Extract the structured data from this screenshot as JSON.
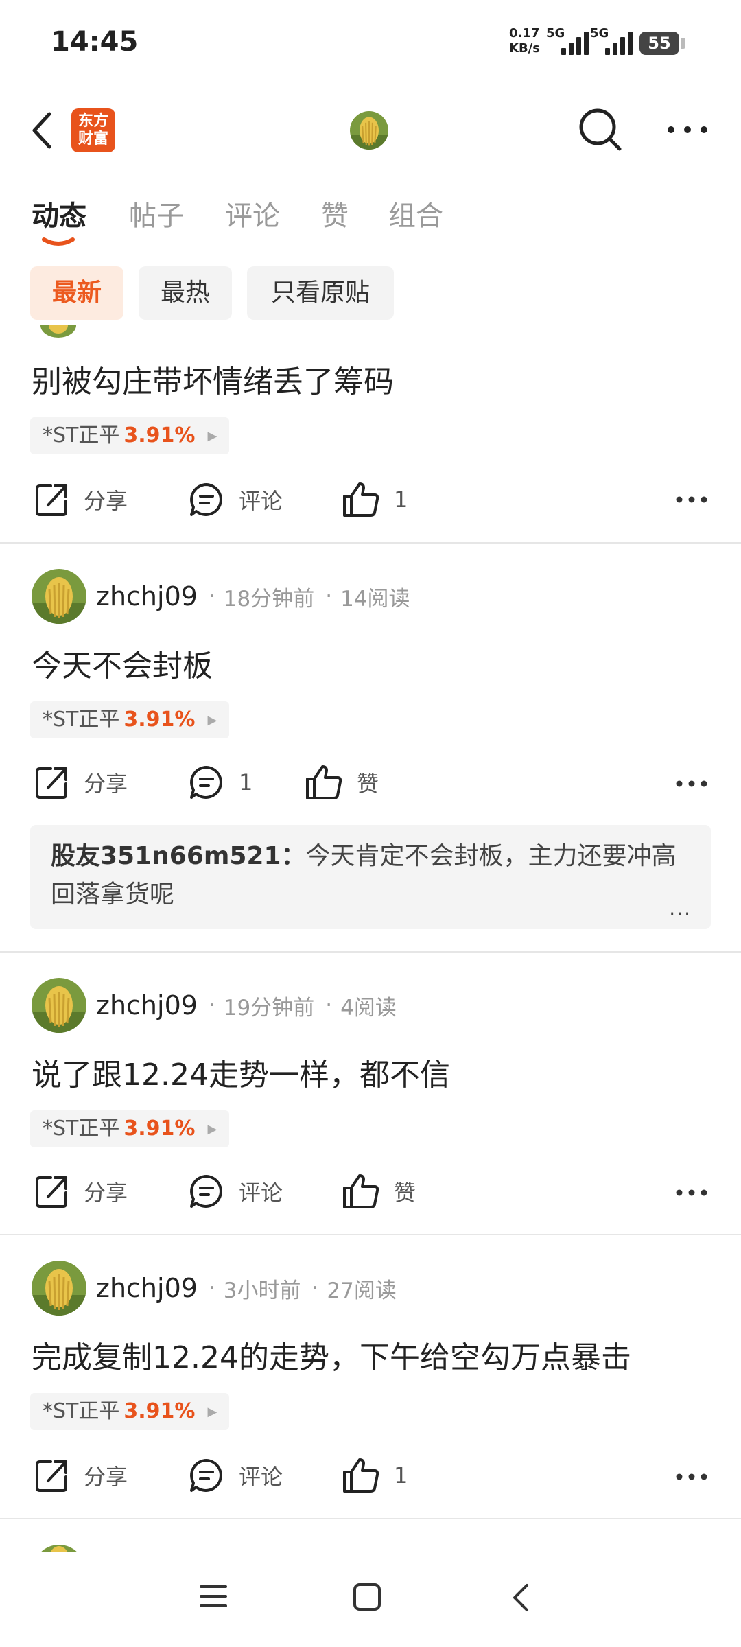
{
  "status_bar": {
    "time": "14:45",
    "net_speed_value": "0.17",
    "net_speed_unit": "KB/s",
    "network_1": "5G",
    "network_2": "5G",
    "battery": "55"
  },
  "header": {
    "logo_line1": "东方",
    "logo_line2": "财富",
    "icons": [
      "back-icon",
      "search-icon",
      "more-icon"
    ]
  },
  "tabs": [
    {
      "label": "动态",
      "active": true
    },
    {
      "label": "帖子",
      "active": false
    },
    {
      "label": "评论",
      "active": false
    },
    {
      "label": "赞",
      "active": false
    },
    {
      "label": "组合",
      "active": false
    }
  ],
  "filters": [
    {
      "label": "最新",
      "active": true
    },
    {
      "label": "最热",
      "active": false
    },
    {
      "label": "只看原贴",
      "active": false
    }
  ],
  "colors": {
    "accent": "#e8531c",
    "chip_active_bg": "#fdebe0"
  },
  "posts": [
    {
      "text": "别被勾庄带坏情绪丢了筹码",
      "stock": {
        "name": "*ST正平",
        "change": "3.91%"
      },
      "share": "分享",
      "comment": "评论",
      "like": "1"
    },
    {
      "user": "zhchj09",
      "time": "18分钟前",
      "reads": "14阅读",
      "text": "今天不会封板",
      "stock": {
        "name": "*ST正平",
        "change": "3.91%"
      },
      "share": "分享",
      "comment": "1",
      "like": "赞",
      "reply": {
        "user": "股友351n66m521：",
        "text": "今天肯定不会封板，主力还要冲高回落拿货呢",
        "more": "..."
      }
    },
    {
      "user": "zhchj09",
      "time": "19分钟前",
      "reads": "4阅读",
      "text": "说了跟12.24走势一样，都不信",
      "stock": {
        "name": "*ST正平",
        "change": "3.91%"
      },
      "share": "分享",
      "comment": "评论",
      "like": "赞"
    },
    {
      "user": "zhchj09",
      "time": "3小时前",
      "reads": "27阅读",
      "text": "完成复制12.24的走势，下午给空勾万点暴击",
      "stock": {
        "name": "*ST正平",
        "change": "3.91%"
      },
      "share": "分享",
      "comment": "评论",
      "like": "1"
    }
  ],
  "nav_bar": {
    "icons": [
      "menu-icon",
      "home-icon",
      "back-nav-icon"
    ]
  }
}
